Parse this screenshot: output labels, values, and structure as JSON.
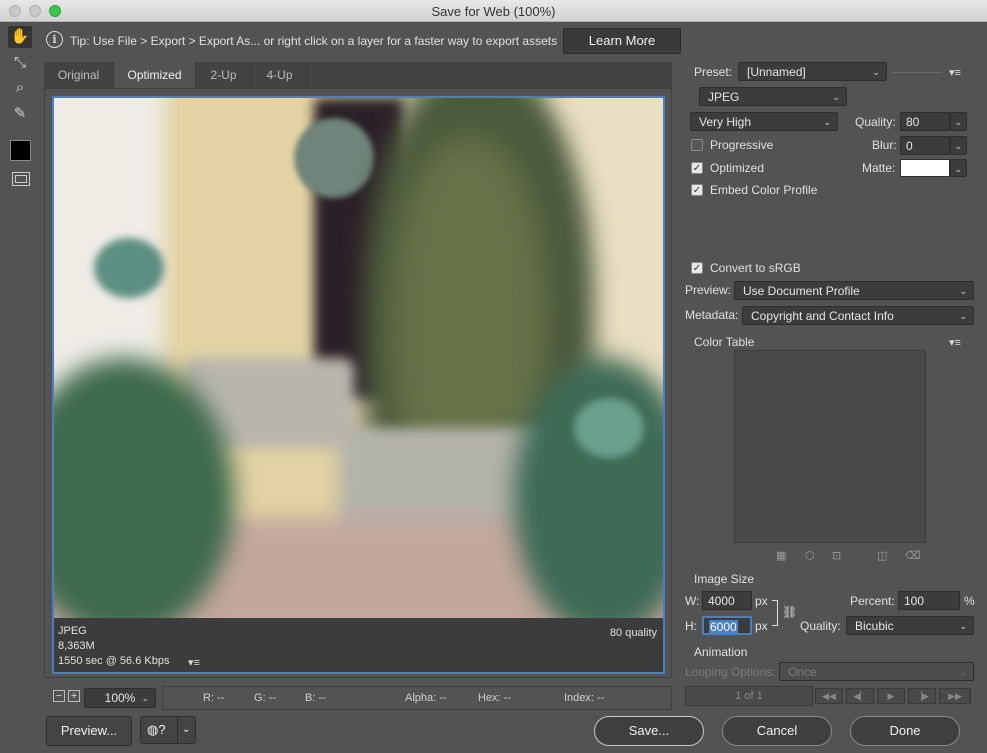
{
  "window": {
    "title": "Save for Web (100%)"
  },
  "tools": [
    {
      "icon": "hand-icon",
      "glyph": "✋"
    },
    {
      "icon": "slice-select-icon",
      "glyph": "⤡"
    },
    {
      "icon": "zoom-icon",
      "glyph": "⌕"
    },
    {
      "icon": "eyedropper-icon",
      "glyph": "✎"
    }
  ],
  "tip": {
    "text": "Tip: Use File > Export > Export As...  or right click on a layer for a faster way to export assets",
    "learn_more": "Learn More"
  },
  "tabs": [
    "Original",
    "Optimized",
    "2-Up",
    "4-Up"
  ],
  "active_tab": "Optimized",
  "image_info": {
    "format": "JPEG",
    "size": "8,363M",
    "download_time": "1550 sec @ 56.6 Kbps",
    "quality": "80 quality"
  },
  "status": {
    "zoom": "100%",
    "r": "R: --",
    "g": "G: --",
    "b": "B: --",
    "alpha": "Alpha: --",
    "hex": "Hex: --",
    "index": "Index: --"
  },
  "buttons": {
    "preview": "Preview...",
    "save": "Save...",
    "cancel": "Cancel",
    "done": "Done"
  },
  "settings": {
    "preset_label": "Preset:",
    "preset_value": "[Unnamed]",
    "format": "JPEG",
    "quality_preset": "Very High",
    "quality_label": "Quality:",
    "quality_value": "80",
    "blur_label": "Blur:",
    "blur_value": "0",
    "matte_label": "Matte:",
    "matte_color": "#ffffff",
    "progressive": {
      "label": "Progressive",
      "checked": false
    },
    "optimized": {
      "label": "Optimized",
      "checked": true
    },
    "embed_profile": {
      "label": "Embed Color Profile",
      "checked": true
    },
    "convert_srgb": {
      "label": "Convert to sRGB",
      "checked": true
    },
    "preview_label": "Preview:",
    "preview_value": "Use Document Profile",
    "metadata_label": "Metadata:",
    "metadata_value": "Copyright and Contact Info",
    "color_table": "Color Table"
  },
  "image_size": {
    "heading": "Image Size",
    "w_label": "W:",
    "w_value": "4000",
    "w_unit": "px",
    "h_label": "H:",
    "h_value": "6000",
    "h_unit": "px",
    "percent_label": "Percent:",
    "percent_value": "100",
    "percent_unit": "%",
    "quality_label": "Quality:",
    "quality_value": "Bicubic"
  },
  "animation": {
    "heading": "Animation",
    "looping_label": "Looping Options:",
    "looping_value": "Once",
    "frame": "1 of 1"
  }
}
